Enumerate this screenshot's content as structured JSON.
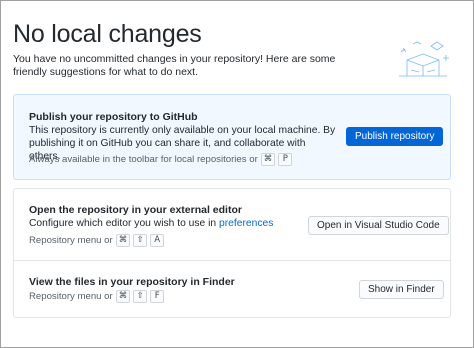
{
  "header": {
    "title": "No local changes",
    "subtitle": "You have no uncommitted changes in your repository! Here are some friendly suggestions for what to do next."
  },
  "publish": {
    "title": "Publish your repository to GitHub",
    "description": "This repository is currently only available on your local machine. By publishing it on GitHub you can share it, and collaborate with others.",
    "hint": "Always available in the toolbar for local repositories or",
    "shortcut": [
      "⌘",
      "P"
    ],
    "button_label": "Publish repository"
  },
  "editor": {
    "title": "Open the repository in your external editor",
    "description_prefix": "Configure which editor you wish to use in ",
    "description_link": "preferences",
    "hint": "Repository menu or",
    "shortcut": [
      "⌘",
      "⇧",
      "A"
    ],
    "button_label": "Open in Visual Studio Code"
  },
  "finder": {
    "title": "View the files in your repository in Finder",
    "hint": "Repository menu or",
    "shortcut": [
      "⌘",
      "⇧",
      "F"
    ],
    "button_label": "Show in Finder"
  },
  "colors": {
    "accent": "#0366d6",
    "primary_card_bg": "#f1f8ff",
    "primary_card_border": "#c8e1ff"
  }
}
